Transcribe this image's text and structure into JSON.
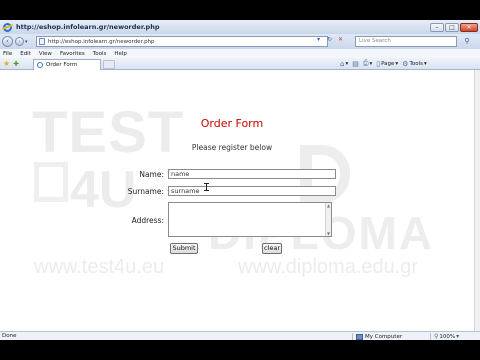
{
  "window": {
    "title": "http://eshop.infolearn.gr/neworder.php",
    "minimize_label": "–",
    "maximize_label": "□",
    "close_label": "✕"
  },
  "addressbar": {
    "url": "http://eshop.infolearn.gr/neworder.php",
    "refresh_icon": "↻",
    "stop_icon": "✕"
  },
  "search": {
    "placeholder": "Live Search",
    "button_icon": "⚲"
  },
  "menu": [
    "File",
    "Edit",
    "View",
    "Favorites",
    "Tools",
    "Help"
  ],
  "tab": {
    "label": "Order Form"
  },
  "commandbar": {
    "page_label": "Page",
    "tools_label": "Tools"
  },
  "watermark": {
    "test": "TEST",
    "four_u": "4U",
    "diploma": "DIPLOMA",
    "url_left": "www.test4u.eu",
    "url_right": "www.diploma.edu.gr"
  },
  "form": {
    "title": "Order Form",
    "subtitle": "Please register below",
    "name_label": "Name:",
    "name_value": "name",
    "surname_label": "Surname:",
    "surname_value": "surname",
    "address_label": "Address:",
    "submit_label": "Submit",
    "clear_label": "clear"
  },
  "status": {
    "text": "Done",
    "zone": "My Computer",
    "zoom": "100%"
  },
  "colors": {
    "form_title": "#cc0000",
    "close_button": "#d2462d"
  }
}
